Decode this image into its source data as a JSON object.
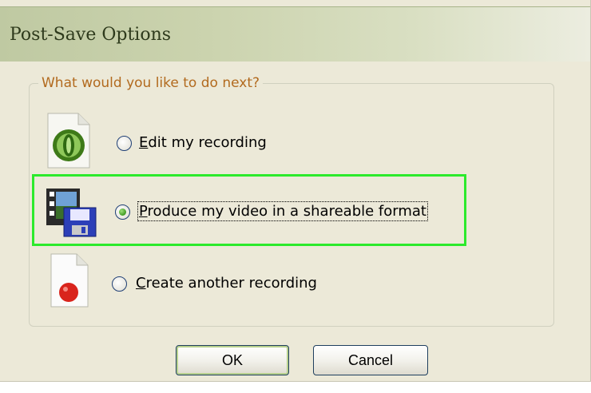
{
  "window": {
    "title": "Post-Save Options"
  },
  "group": {
    "label": "What would you like to do next?"
  },
  "options": [
    {
      "mnemonic": "E",
      "rest": "dit my recording",
      "icon": "camtasia-edit-icon",
      "selected": false
    },
    {
      "mnemonic": "P",
      "rest": "roduce my video in a shareable format",
      "icon": "film-floppy-icon",
      "selected": true
    },
    {
      "mnemonic": "C",
      "rest": "reate another recording",
      "icon": "record-document-icon",
      "selected": false
    }
  ],
  "buttons": {
    "ok": "OK",
    "cancel": "Cancel"
  },
  "colors": {
    "dialog_bg": "#ece9d8",
    "group_label": "#b26a1e",
    "focus_highlight": "#2cea2c",
    "radio_dot": "#3f9a22"
  }
}
